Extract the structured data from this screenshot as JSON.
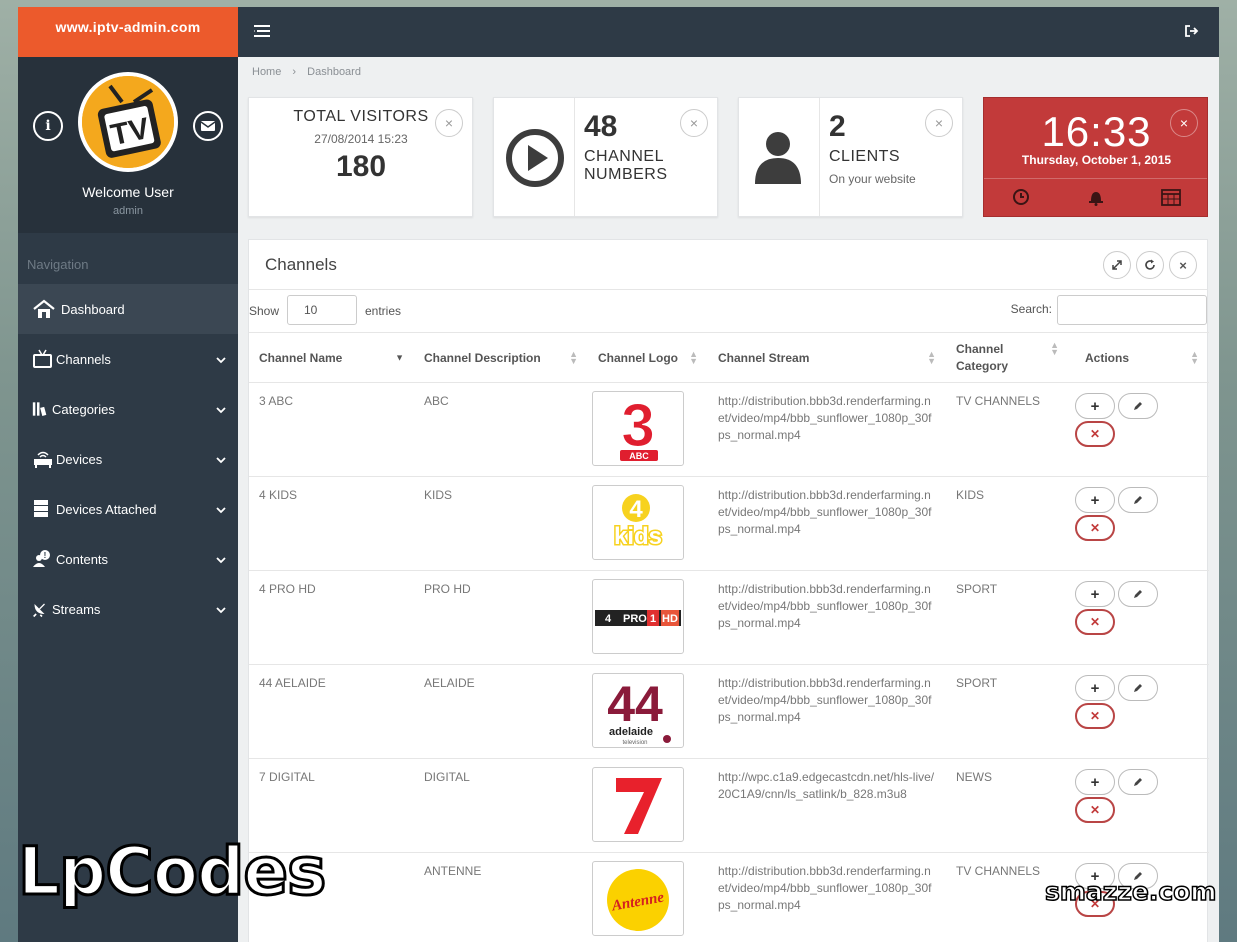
{
  "brand": "www.iptv-admin.com",
  "profile": {
    "welcome": "Welcome User",
    "role": "admin",
    "avatar_text": "TV"
  },
  "nav": {
    "heading": "Navigation",
    "items": [
      {
        "label": "Dashboard",
        "icon": "home-icon",
        "active": true
      },
      {
        "label": "Channels",
        "icon": "tv-icon"
      },
      {
        "label": "Categories",
        "icon": "library-icon"
      },
      {
        "label": "Devices",
        "icon": "router-icon"
      },
      {
        "label": "Devices Attached",
        "icon": "server-icon"
      },
      {
        "label": "Contents",
        "icon": "users-info-icon"
      },
      {
        "label": "Streams",
        "icon": "satellite-dish-icon"
      }
    ]
  },
  "breadcrumb": {
    "home": "Home",
    "current": "Dashboard"
  },
  "stats": {
    "visitors": {
      "title": "TOTAL VISITORS",
      "date": "27/08/2014 15:23",
      "value": "180"
    },
    "channels": {
      "value": "48",
      "label1": "CHANNEL",
      "label2": "NUMBERS"
    },
    "clients": {
      "value": "2",
      "label": "CLIENTS",
      "sub": "On your website"
    }
  },
  "clock": {
    "time": "16:33",
    "date": "Thursday, October 1, 2015"
  },
  "panel": {
    "title": "Channels",
    "show_label": "Show",
    "length_value": "10",
    "entries_label": "entries",
    "search_label": "Search:",
    "columns": [
      "Channel Name",
      "Channel Description",
      "Channel Logo",
      "Channel Stream",
      "Channel Category",
      "Actions"
    ],
    "category_header": [
      "Channel",
      "Category"
    ]
  },
  "rows": [
    {
      "name": "3 ABC",
      "desc": "ABC",
      "logo": "3abc",
      "stream": "http://distribution.bbb3d.renderfarming.net/video/mp4/bbb_sunflower_1080p_30fps_normal.mp4",
      "category": "TV CHANNELS"
    },
    {
      "name": "4 KIDS",
      "desc": "KIDS",
      "logo": "4kids",
      "stream": "http://distribution.bbb3d.renderfarming.net/video/mp4/bbb_sunflower_1080p_30fps_normal.mp4",
      "category": "KIDS"
    },
    {
      "name": "4 PRO HD",
      "desc": "PRO HD",
      "logo": "4pro",
      "stream": "http://distribution.bbb3d.renderfarming.net/video/mp4/bbb_sunflower_1080p_30fps_normal.mp4",
      "category": "SPORT"
    },
    {
      "name": "44 AELAIDE",
      "desc": "AELAIDE",
      "logo": "44",
      "stream": "http://distribution.bbb3d.renderfarming.net/video/mp4/bbb_sunflower_1080p_30fps_normal.mp4",
      "category": "SPORT"
    },
    {
      "name": "7 DIGITAL",
      "desc": "DIGITAL",
      "logo": "7",
      "stream": "http://wpc.c1a9.edgecastcdn.net/hls-live/20C1A9/cnn/ls_satlink/b_828.m3u8",
      "category": "NEWS"
    },
    {
      "name": "",
      "desc": "ANTENNE",
      "logo": "antenne",
      "stream": "http://distribution.bbb3d.renderfarming.net/video/mp4/bbb_sunflower_1080p_30fps_normal.mp4",
      "category": "TV CHANNELS"
    }
  ],
  "logos": {
    "3abc": {
      "main": "3",
      "sub": "ABC"
    },
    "4kids": {
      "main": "4",
      "sub": "kids"
    },
    "4pro": {
      "a": "4",
      "b": "PRO",
      "c": "1",
      "d": "HD"
    },
    "44": {
      "main": "44",
      "sub": "adelaide",
      "sub2": "television"
    },
    "7": {
      "main": "7"
    },
    "antenne": {
      "main": "Antenne"
    }
  },
  "actions": {
    "add": "+",
    "delete": "✕"
  },
  "watermarks": {
    "left": "LpCodes",
    "right": "smazze.com"
  },
  "colors": {
    "brand": "#ec5a2c",
    "sidebar": "#2e3a46",
    "clock": "#c23a3a",
    "delete": "#c23a3a"
  }
}
